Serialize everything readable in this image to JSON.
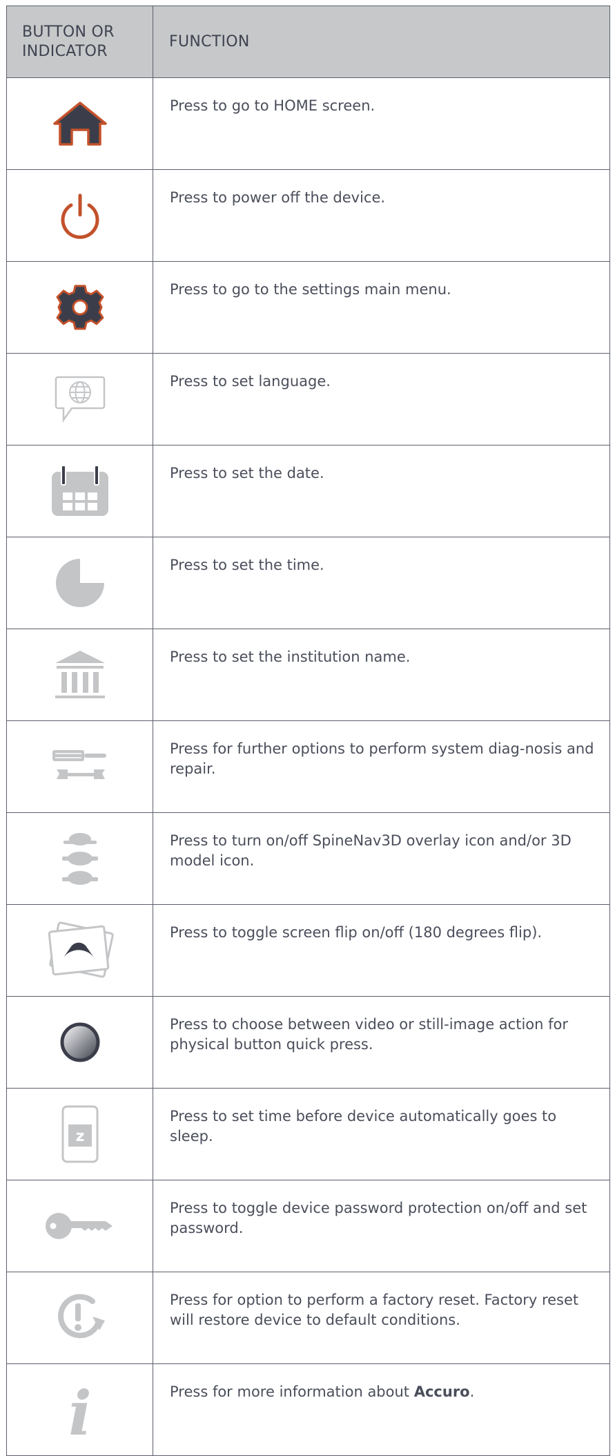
{
  "header": {
    "col1": "BUTTON OR INDICATOR",
    "col2": "FUNCTION"
  },
  "rows": [
    {
      "icon": "home-icon",
      "text": "Press to go to HOME screen."
    },
    {
      "icon": "power-icon",
      "text": "Press to power off the device."
    },
    {
      "icon": "gear-icon",
      "text": "Press to go to the settings main menu."
    },
    {
      "icon": "language-globe-icon",
      "text": "Press to set language."
    },
    {
      "icon": "calendar-icon",
      "text": "Press to set the date."
    },
    {
      "icon": "clock-pie-icon",
      "text": "Press to set the time."
    },
    {
      "icon": "institution-icon",
      "text": "Press to set the institution name."
    },
    {
      "icon": "tools-icon",
      "text": "Press for further options to perform system diag-nosis and repair."
    },
    {
      "icon": "spine-icon",
      "text": "Press to turn on/off SpineNav3D overlay icon and/or 3D model icon."
    },
    {
      "icon": "screen-flip-icon",
      "text": "Press to toggle screen flip on/off (180 degrees flip)."
    },
    {
      "icon": "record-button-icon",
      "text": "Press to choose between video or still-image action for physical button quick press."
    },
    {
      "icon": "sleep-icon",
      "text": "Press to set time before device automatically goes to sleep."
    },
    {
      "icon": "key-icon",
      "text": "Press to toggle device password protection on/off and set password."
    },
    {
      "icon": "factory-reset-icon",
      "text": "Press for option to perform a factory reset. Factory reset will restore device to default conditions."
    },
    {
      "icon": "info-icon",
      "text_before": "Press for more information about ",
      "text_bold": "Accuro",
      "text_after": "."
    }
  ],
  "sleep_icon_letter": "z",
  "info_icon_letter": "i",
  "colors": {
    "orange": "#c3512b",
    "dark": "#3b3e4a",
    "gray": "#c4c5c7",
    "header_bg": "#c7c8ca",
    "text": "#4a4e5a"
  }
}
